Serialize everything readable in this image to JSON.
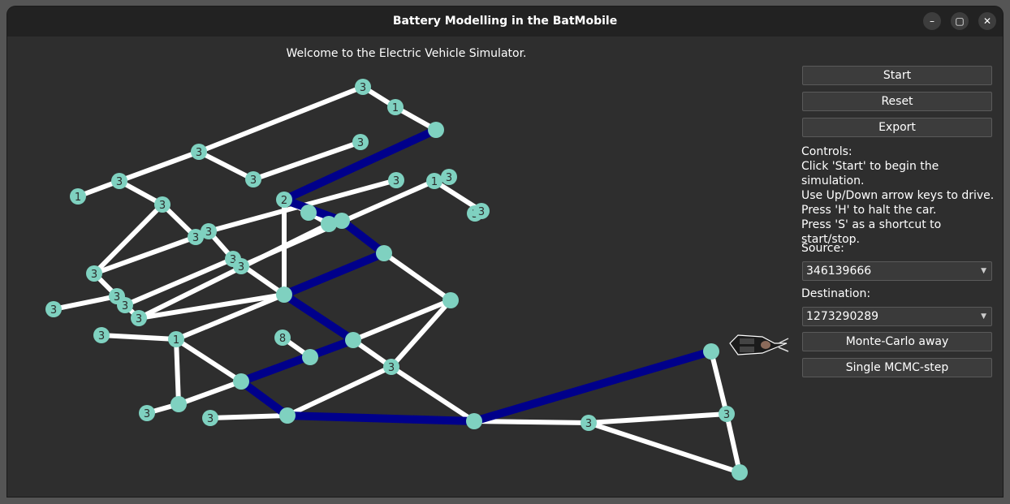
{
  "window": {
    "title": "Battery Modelling in the BatMobile",
    "minimize_icon": "–",
    "maximize_icon": "▢",
    "close_icon": "✕"
  },
  "welcome": "Welcome to the Electric Vehicle Simulator.",
  "buttons": {
    "start": "Start",
    "reset": "Reset",
    "export": "Export",
    "monte_carlo": "Monte-Carlo away",
    "mcmc_step": "Single MCMC-step"
  },
  "controls": {
    "heading": "Controls:",
    "lines": [
      "Click 'Start' to begin the simulation.",
      "Use Up/Down arrow keys to drive.",
      "Press 'H' to halt the car.",
      "Press 'S' as a shortcut to start/stop."
    ]
  },
  "source": {
    "label": "Source:",
    "value": "346139666"
  },
  "destination": {
    "label": "Destination:",
    "value": "1273290289"
  },
  "colors": {
    "node": "#7fd1c0",
    "edge": "#ffffff",
    "route": "#00008b"
  },
  "graph": {
    "node_labels": [
      "3",
      "1",
      "3",
      "3",
      "3",
      "3",
      "1",
      "3",
      "2",
      "3",
      "3",
      "3",
      "1",
      "3",
      "3",
      "3",
      "3",
      "3",
      "3",
      "3",
      "3",
      "3",
      "3",
      "3",
      "1",
      "8",
      "3",
      "3",
      "3",
      "3",
      "3"
    ]
  }
}
